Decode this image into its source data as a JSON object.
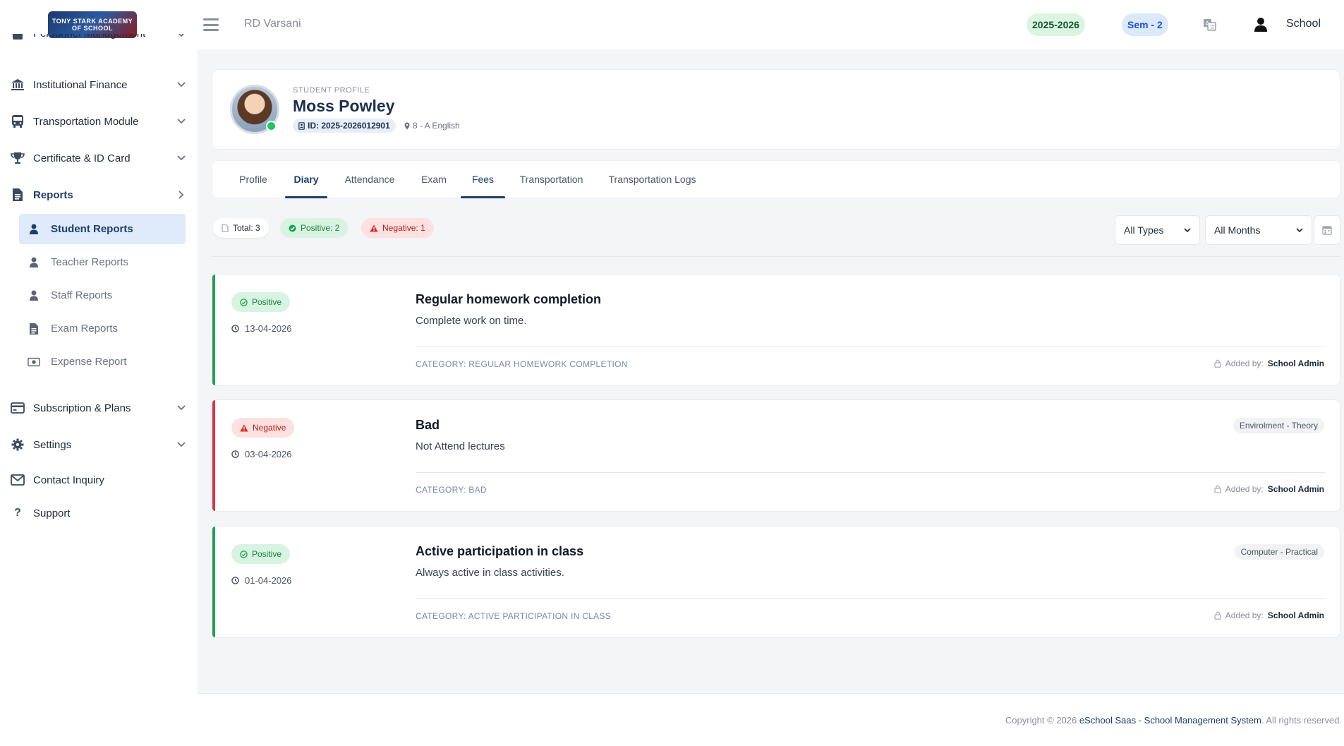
{
  "brand": {
    "logo_text": "TONY STARK ACADEMY OF SCHOOL"
  },
  "sidebar": {
    "items": [
      {
        "label": "Personnel Management",
        "icon": "users-icon"
      },
      {
        "label": "Institutional Finance",
        "icon": "bank-icon"
      },
      {
        "label": "Transportation Module",
        "icon": "bus-icon"
      },
      {
        "label": "Certificate & ID Card",
        "icon": "trophy-icon"
      },
      {
        "label": "Reports",
        "icon": "report-icon"
      },
      {
        "label": "Subscription & Plans",
        "icon": "credit-card-icon"
      },
      {
        "label": "Settings",
        "icon": "gear-icon"
      },
      {
        "label": "Contact Inquiry",
        "icon": "envelope-icon"
      },
      {
        "label": "Support",
        "icon": "question-icon"
      }
    ],
    "reports_sub": [
      {
        "label": "Student Reports",
        "icon": "user-icon"
      },
      {
        "label": "Teacher Reports",
        "icon": "user-icon"
      },
      {
        "label": "Staff Reports",
        "icon": "user-icon"
      },
      {
        "label": "Exam Reports",
        "icon": "document-icon"
      },
      {
        "label": "Expense Report",
        "icon": "money-icon"
      }
    ]
  },
  "header": {
    "school_name": "RD Varsani",
    "session": "2025-2026",
    "semester": "Sem - 2",
    "user_label": "School"
  },
  "profile": {
    "kicker": "STUDENT PROFILE",
    "name": "Moss Powley",
    "id_label": "ID: 2025-2026012901",
    "class_label": "8 - A English"
  },
  "tabs": [
    "Profile",
    "Diary",
    "Attendance",
    "Exam",
    "Fees",
    "Transportation",
    "Transportation Logs"
  ],
  "stats": {
    "total": "Total: 3",
    "positive": "Positive: 2",
    "negative": "Negative: 1"
  },
  "filters": {
    "type": "All Types",
    "month": "All Months"
  },
  "entries": [
    {
      "type": "Positive",
      "date": "13-04-2026",
      "title": "Regular homework completion",
      "description": "Complete work on time.",
      "category": "CATEGORY: REGULAR HOMEWORK COMPLETION",
      "added_by_label": "Added by:",
      "added_by": "School Admin",
      "subject": ""
    },
    {
      "type": "Negative",
      "date": "03-04-2026",
      "title": "Bad",
      "description": "Not Attend lectures",
      "category": "CATEGORY: BAD",
      "added_by_label": "Added by:",
      "added_by": "School Admin",
      "subject": "Envirolment - Theory"
    },
    {
      "type": "Positive",
      "date": "01-04-2026",
      "title": "Active participation in class",
      "description": "Always active in class activities.",
      "category": "CATEGORY: ACTIVE PARTICIPATION IN CLASS",
      "added_by_label": "Added by:",
      "added_by": "School Admin",
      "subject": "Computer - Practical"
    }
  ],
  "footer": {
    "prefix": "Copyright © 2026 ",
    "link": "eSchool Saas - School Management System",
    "suffix": ". All rights reserved."
  },
  "colors": {
    "accent": "#1d3e6a",
    "positive": "#22a05a",
    "negative": "#dc3545"
  }
}
